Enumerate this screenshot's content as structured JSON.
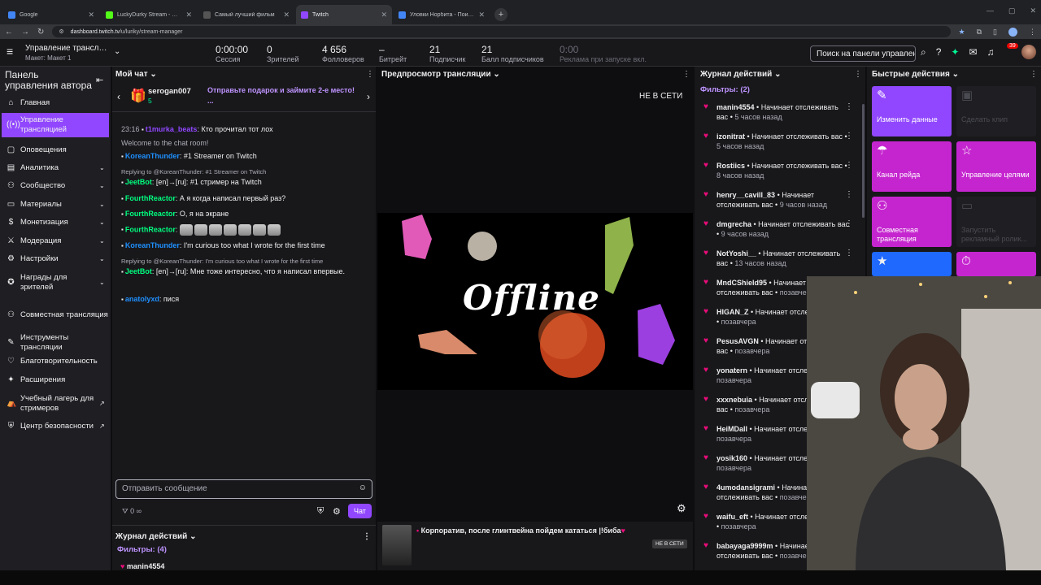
{
  "browser": {
    "tabs": [
      {
        "title": "Google",
        "color": "#4285f4",
        "active": false
      },
      {
        "title": "LuckyDurky Stream - Watch Li...",
        "color": "#53fc18",
        "active": false
      },
      {
        "title": "Самый лучший фильм",
        "color": "#555555",
        "active": false
      },
      {
        "title": "Twitch",
        "color": "#9147ff",
        "active": true
      },
      {
        "title": "Уловки Норбита - Поиск в Go...",
        "color": "#4285f4",
        "active": false
      }
    ],
    "url_domain": "dashboard.twitch.tv",
    "url_path": "/u/luriky/stream-manager"
  },
  "header": {
    "channel_title": "Управление трансляц...",
    "layout": "Макет: Макет 1",
    "stats": [
      {
        "value": "0:00:00",
        "label": "Сессия",
        "dim": false
      },
      {
        "value": "0",
        "label": "Зрителей",
        "dim": false
      },
      {
        "value": "4 656",
        "label": "Фолловеров",
        "dim": false
      },
      {
        "value": "–",
        "label": "Битрейт",
        "dim": false
      },
      {
        "value": "21",
        "label": "Подписчик",
        "dim": false
      },
      {
        "value": "21",
        "label": "Балл подписчиков",
        "dim": false
      },
      {
        "value": "0:00",
        "label": "Реклама при запуске вкл.",
        "dim": true
      }
    ],
    "search_placeholder": "Поиск на панели управления",
    "notif_count": "39"
  },
  "nav": {
    "title": "Панель управления автора",
    "items": [
      {
        "label": "Главная",
        "icon": "⌂",
        "chevron": false,
        "ext": false,
        "active": false
      },
      {
        "label": "Управление трансляцией",
        "icon": "((•))",
        "chevron": false,
        "ext": false,
        "active": true
      },
      {
        "label": "Оповещения",
        "icon": "▢",
        "chevron": false,
        "ext": false,
        "active": false
      },
      {
        "label": "Аналитика",
        "icon": "▤",
        "chevron": true,
        "ext": false,
        "active": false
      },
      {
        "label": "Сообщество",
        "icon": "⚇",
        "chevron": true,
        "ext": false,
        "active": false
      },
      {
        "label": "Материалы",
        "icon": "▭",
        "chevron": true,
        "ext": false,
        "active": false
      },
      {
        "label": "Монетизация",
        "icon": "$",
        "chevron": true,
        "ext": false,
        "active": false
      },
      {
        "label": "Модерация",
        "icon": "⚔",
        "chevron": true,
        "ext": false,
        "active": false
      },
      {
        "label": "Настройки",
        "icon": "⚙",
        "chevron": true,
        "ext": false,
        "active": false
      },
      {
        "label": "Награды для зрителей",
        "icon": "✪",
        "chevron": true,
        "ext": false,
        "active": false
      },
      {
        "label": "Совместная трансляция",
        "icon": "⚇",
        "chevron": false,
        "ext": false,
        "active": false
      },
      {
        "label": "Инструменты трансляции",
        "icon": "✎",
        "chevron": false,
        "ext": false,
        "active": false
      },
      {
        "label": "Благотворительность",
        "icon": "♡",
        "chevron": false,
        "ext": false,
        "active": false
      },
      {
        "label": "Расширения",
        "icon": "✦",
        "chevron": false,
        "ext": false,
        "active": false
      },
      {
        "label": "Учебный лагерь для стримеров",
        "icon": "⛺",
        "chevron": false,
        "ext": true,
        "active": false
      },
      {
        "label": "Центр безопасности",
        "icon": "⛨",
        "chevron": false,
        "ext": true,
        "active": false
      }
    ]
  },
  "chat": {
    "title": "Мой чат",
    "gift_user": "serogan007",
    "gift_count": "5",
    "gift_text": "Отправьте подарок и займите 2-е место!",
    "gift_more": "...",
    "messages": [
      {
        "time": "23:16",
        "user": "t1murka_beats",
        "color": "#9147ff",
        "text": "Кто прочитал тот лох",
        "reply": ""
      },
      {
        "time": "",
        "user": "",
        "color": "",
        "text": "Welcome to the chat room!",
        "reply": "",
        "system": true
      },
      {
        "time": "",
        "user": "KoreanThunder",
        "color": "#1e90ff",
        "text": "#1 Streamer on Twitch",
        "reply": ""
      },
      {
        "time": "",
        "user": "JeetBot",
        "color": "#00ff7f",
        "text": "[en]→[ru]: #1 стример на Twitch",
        "reply": "Replying to @KoreanThunder: #1 Streamer on Twitch"
      },
      {
        "time": "",
        "user": "FourthReactor",
        "color": "#00ff7f",
        "text": "А я когда написал первый раз?",
        "reply": ""
      },
      {
        "time": "",
        "user": "FourthReactor",
        "color": "#00ff7f",
        "text": "О, я на экране",
        "reply": ""
      },
      {
        "time": "",
        "user": "FourthReactor",
        "color": "#00ff7f",
        "text": "",
        "reply": "",
        "emotes": 7
      },
      {
        "time": "",
        "user": "KoreanThunder",
        "color": "#1e90ff",
        "text": "I'm curious too what I wrote for the first time",
        "reply": ""
      },
      {
        "time": "",
        "user": "JeetBot",
        "color": "#00ff7f",
        "text": "[en]→[ru]: Мне тоже интересно, что я написал впервые.",
        "reply": "Replying to @KoreanThunder: I'm curious too what I wrote for the first time"
      },
      {
        "time": "",
        "user": "anatolyxd",
        "color": "#1e90ff",
        "text": "пися",
        "reply": ""
      }
    ],
    "input_placeholder": "Отправить сообщение",
    "points": "0",
    "send_label": "Чат",
    "activity_title": "Журнал действий",
    "activity_filters": "Фильтры: (4)",
    "activity_first": "manin4554"
  },
  "preview": {
    "title": "Предпросмотр трансляции",
    "status": "НЕ В СЕТИ",
    "offline_text": "Offline",
    "stream_title": "Корпоратив, после глинтвейна пойдем кататься |!биба",
    "stream_badge": "НЕ В СЕТИ"
  },
  "activity": {
    "title": "Журнал действий",
    "filters": "Фильтры: (2)",
    "items": [
      {
        "user": "manin4554",
        "action": "Начинает отслеживать вас",
        "time": "5 часов назад"
      },
      {
        "user": "izonitrat",
        "action": "Начинает отслеживать вас",
        "time": "5 часов назад"
      },
      {
        "user": "Rostiics",
        "action": "Начинает отслеживать вас",
        "time": "8 часов назад"
      },
      {
        "user": "henry__cavill_83",
        "action": "Начинает отслеживать вас",
        "time": "9 часов назад"
      },
      {
        "user": "dmgrecha",
        "action": "Начинает отслеживать вас",
        "time": "9 часов назад"
      },
      {
        "user": "NotYoshi__",
        "action": "Начинает отслеживать вас",
        "time": "13 часов назад"
      },
      {
        "user": "MndCShield95",
        "action": "Начинает отслеживать вас",
        "time": "позавчера"
      },
      {
        "user": "HIGAN_Z",
        "action": "Начинает отслеживать вас",
        "time": "позавчера"
      },
      {
        "user": "PesusAVGN",
        "action": "Начинает отслеживать вас",
        "time": "позавчера"
      },
      {
        "user": "yonatern",
        "action": "Начинает отслеживать вас",
        "time": "позавчера"
      },
      {
        "user": "xxxnebuia",
        "action": "Начинает отслеживать вас",
        "time": "позавчера"
      },
      {
        "user": "HeiMDall",
        "action": "Начинает отслеживать вас",
        "time": "позавчера"
      },
      {
        "user": "yosik160",
        "action": "Начинает отслеживать вас",
        "time": "позавчера"
      },
      {
        "user": "4umodansigrami",
        "action": "Начинает отслеживать вас",
        "time": "позавчера"
      },
      {
        "user": "waifu_eft",
        "action": "Начинает отслеживать вас",
        "time": "позавчера"
      },
      {
        "user": "babayaga9999m",
        "action": "Начинает отслеживать вас",
        "time": "позавчера"
      }
    ]
  },
  "quick": {
    "title": "Быстрые действия",
    "tiles": [
      {
        "label": "Изменить данные",
        "icon": "✎",
        "style": "on-purple"
      },
      {
        "label": "Сделать клип",
        "icon": "▣",
        "style": "off"
      },
      {
        "label": "Канал рейда",
        "icon": "☂",
        "style": "on"
      },
      {
        "label": "Управление целями",
        "icon": "☆",
        "style": "on"
      },
      {
        "label": "Совместная трансляция",
        "icon": "⚇",
        "style": "on"
      },
      {
        "label": "Запустить рекламный ролик...",
        "icon": "▭",
        "style": "off"
      },
      {
        "label": "",
        "icon": "★",
        "style": "blue"
      },
      {
        "label": "",
        "icon": "⏱",
        "style": "on"
      }
    ]
  }
}
